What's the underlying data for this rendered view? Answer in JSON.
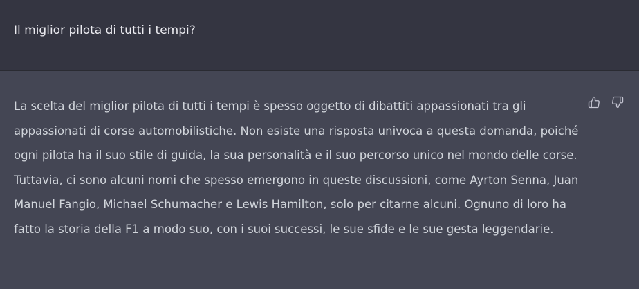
{
  "conversation": {
    "user_message": "Il miglior pilota di tutti i tempi?",
    "assistant_message": "La scelta del miglior pilota di tutti i tempi è spesso oggetto di dibattiti appassionati tra gli appassionati di corse automobilistiche. Non esiste una risposta univoca a questa domanda, poiché ogni pilota ha il suo stile di guida, la sua personalità e il suo percorso unico nel mondo delle corse. Tuttavia, ci sono alcuni nomi che spesso emergono in queste discussioni, come Ayrton Senna, Juan Manuel Fangio, Michael Schumacher e Lewis Hamilton, solo per citarne alcuni. Ognuno di loro ha fatto la storia della F1 a modo suo, con i suoi successi, le sue sfide e le sue gesta leggendarie."
  },
  "feedback": {
    "thumbs_up_icon": "thumbs-up-icon",
    "thumbs_down_icon": "thumbs-down-icon"
  },
  "colors": {
    "user_bg": "#343541",
    "assistant_bg": "#444654",
    "text": "#d1d5db"
  }
}
